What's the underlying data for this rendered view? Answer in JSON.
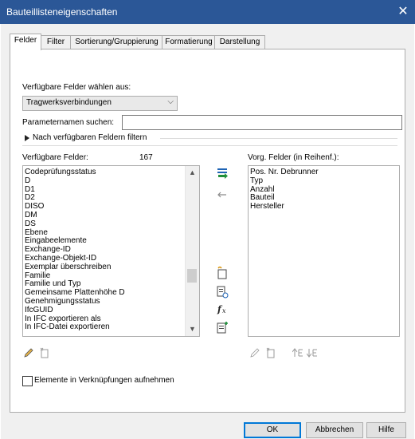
{
  "window": {
    "title": "Bauteillisteneigenschaften",
    "close_glyph": "✕"
  },
  "tabs": [
    {
      "label": "Felder",
      "active": true
    },
    {
      "label": "Filter",
      "active": false
    },
    {
      "label": "Sortierung/Gruppierung",
      "active": false
    },
    {
      "label": "Formatierung",
      "active": false
    },
    {
      "label": "Darstellung",
      "active": false
    }
  ],
  "fields_tab": {
    "select_label": "Verfügbare Felder wählen aus:",
    "select_value": "Tragwerksverbindungen",
    "param_search_label": "Parameternamen suchen:",
    "param_search_value": "",
    "filter_expander_label": "Nach verfügbaren Feldern filtern",
    "available_label": "Verfügbare Felder:",
    "available_count": "167",
    "available_fields": [
      "Codeprüfungsstatus",
      "D",
      "D1",
      "D2",
      "DISO",
      "DM",
      "DS",
      "Ebene",
      "Eingabeelemente",
      "Exchange-ID",
      "Exchange-Objekt-ID",
      "Exemplar überschreiben",
      "Familie",
      "Familie und Typ",
      "Gemeinsame Plattenhöhe D",
      "Genehmigungsstatus",
      "IfcGUID",
      "In IFC exportieren als",
      "In IFC-Datei exportieren"
    ],
    "scroll_position": 0.7,
    "scroll_visible_fraction": 0.1,
    "selected_label": "Vorg. Felder (in Reihenf.):",
    "selected_fields": [
      "Pos. Nr. Debrunner",
      "Typ",
      "Anzahl",
      "Bauteil",
      "Hersteller"
    ],
    "include_links_label": "Elemente in Verknüpfungen aufnehmen",
    "include_links_checked": false
  },
  "footer": {
    "ok": "OK",
    "cancel": "Abbrechen",
    "help": "Hilfe"
  },
  "icons": {
    "add_field": "add-field-icon",
    "remove_field": "remove-field-icon",
    "new_parameter": "new-parameter-icon",
    "combine_parameters": "combine-parameters-icon",
    "calculated_value": "calculated-value-icon",
    "add_from_link": "add-parameter-from-link-icon",
    "edit_left": "edit-pencil-icon",
    "delete_left": "delete-parameter-icon",
    "edit_right": "edit-pencil-icon",
    "delete_right": "delete-parameter-icon",
    "move_up": "move-up-icon",
    "move_down": "move-down-icon"
  },
  "colors": {
    "titlebar": "#2b5797",
    "accent": "#0078d7",
    "green": "#1f8f3a",
    "blue": "#1e63b5"
  }
}
